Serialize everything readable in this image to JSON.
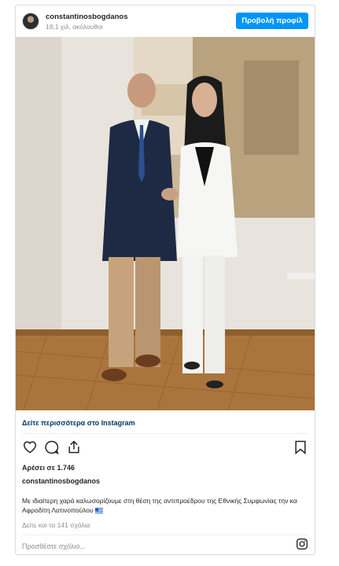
{
  "header": {
    "username": "constantinosbogdanos",
    "followers": "18,1 χιλ. ακόλουθοι",
    "view_profile_label": "Προβολή προφίλ"
  },
  "photo": {
    "description_icon": "post-photo"
  },
  "more_link": "Δείτε περισσότερα στο Instagram",
  "actions": {
    "like_icon": "heart-icon",
    "comment_icon": "comment-icon",
    "share_icon": "share-icon",
    "save_icon": "bookmark-icon"
  },
  "likes": "Αρέσει σε 1.746",
  "owner": "constantinosbogdanos",
  "caption": "Με ιδιαίτερη χαρά καλωσορίζουμε στη θέση της αντιπροέδρου της Εθνικής Συμφωνίας την κα Αφροδίτη Λατινοπούλου",
  "view_comments": "Δείτε και τα 141 σχόλια",
  "comment_placeholder": "Προσθέστε σχόλιο...",
  "colors": {
    "accent": "#0095f6",
    "link": "#00376b"
  }
}
